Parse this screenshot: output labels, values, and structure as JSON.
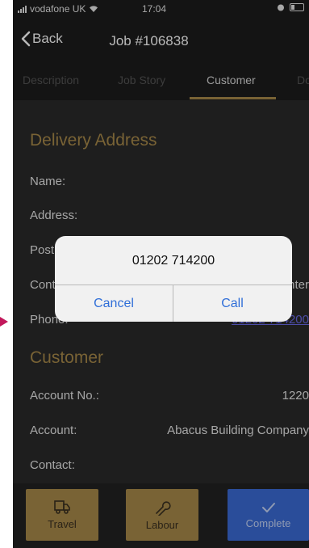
{
  "status_bar": {
    "carrier": "vodafone UK",
    "time": "17:04"
  },
  "nav": {
    "back_label": "Back",
    "title": "Job #106838"
  },
  "tabs": [
    {
      "label": "Description",
      "active": false
    },
    {
      "label": "Job Story",
      "active": false
    },
    {
      "label": "Customer",
      "active": true
    },
    {
      "label": "Do",
      "active": false
    }
  ],
  "delivery": {
    "title": "Delivery Address",
    "name_label": "Name:",
    "address_label": "Address:",
    "post_label": "Post",
    "contact_label": "Cont",
    "contact_value_fragment": "unter",
    "phone_label": "Phone:",
    "phone_value": "01202 714200"
  },
  "customer": {
    "title": "Customer",
    "account_no_label": "Account No.:",
    "account_no_value": "1220",
    "account_label": "Account:",
    "account_value": "Abacus Building Company",
    "contact_label": "Contact:"
  },
  "dialog": {
    "number": "01202 714200",
    "cancel_label": "Cancel",
    "call_label": "Call"
  },
  "bottom_buttons": [
    {
      "label": "Travel",
      "icon": "truck-icon",
      "color": "#a8894a"
    },
    {
      "label": "Labour",
      "icon": "wrench-icon",
      "color": "#a8894a"
    },
    {
      "label": "Complete",
      "icon": "check-icon",
      "color": "#3b6bd6"
    }
  ],
  "colors": {
    "accent_gold": "#a8894a",
    "link_purple": "#6a6ae8",
    "dialog_button_blue": "#2f6ed8"
  }
}
